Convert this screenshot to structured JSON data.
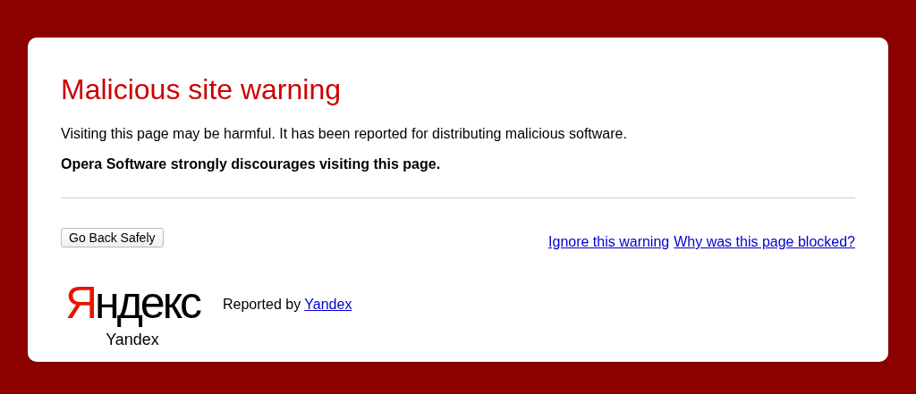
{
  "title": "Malicious site warning",
  "message": "Visiting this page may be harmful. It has been reported for distributing malicious software.",
  "recommendation": "Opera Software strongly discourages visiting this page.",
  "back_button": "Go Back Safely",
  "links": [
    "Ignore this warning",
    "Why was this page blocked?"
  ],
  "reporter": {
    "logo": {
      "word": "Яндекс",
      "caption": "Yandex"
    },
    "label": "Reported by",
    "link": "Yandex"
  }
}
